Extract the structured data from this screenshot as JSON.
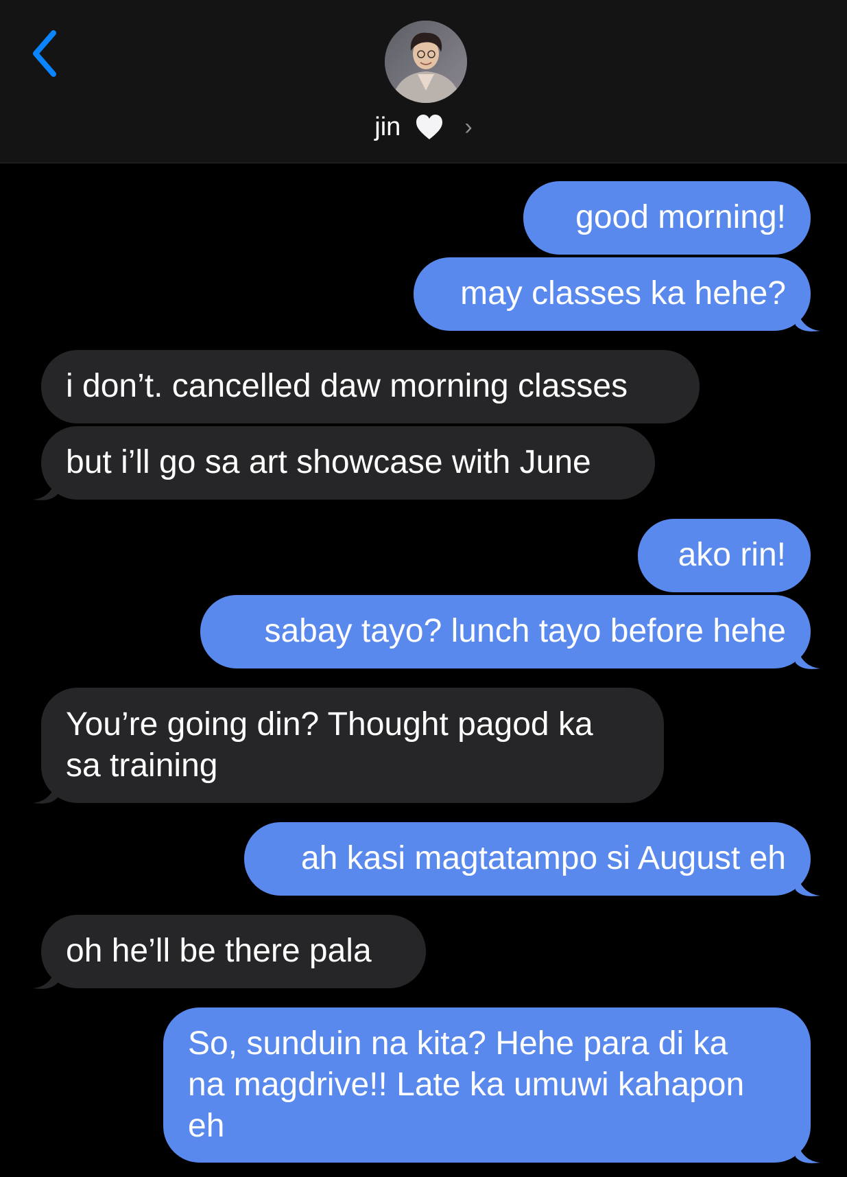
{
  "header": {
    "contact_name": "jin",
    "heart": "🤍",
    "chevron": "›"
  },
  "colors": {
    "accent": "#0a84ff",
    "sent_bubble": "#5a89ee",
    "received_bubble": "#262629",
    "background": "#000000"
  },
  "icons": {
    "back": "chevron-left-icon",
    "heart": "white-heart-icon",
    "details": "chevron-right-icon"
  },
  "messages": [
    {
      "direction": "sent",
      "lines": [
        "good morning!"
      ]
    },
    {
      "direction": "sent",
      "lines": [
        "may classes ka hehe?"
      ]
    },
    {
      "direction": "received",
      "lines": [
        "i don’t. cancelled daw morning classes"
      ]
    },
    {
      "direction": "received",
      "lines": [
        "but i’ll go sa art showcase with June"
      ]
    },
    {
      "direction": "sent",
      "lines": [
        "ako rin!"
      ]
    },
    {
      "direction": "sent",
      "lines": [
        "sabay tayo? lunch tayo before hehe"
      ]
    },
    {
      "direction": "received",
      "lines": [
        "You’re going din? Thought pagod ka",
        "sa training"
      ]
    },
    {
      "direction": "sent",
      "lines": [
        "ah kasi magtatampo si August eh"
      ]
    },
    {
      "direction": "received",
      "lines": [
        "oh he’ll be there pala"
      ]
    },
    {
      "direction": "sent",
      "lines": [
        "So, sunduin na kita? Hehe para di ka",
        "na magdrive!! Late ka umuwi kahapon",
        "eh"
      ]
    }
  ]
}
